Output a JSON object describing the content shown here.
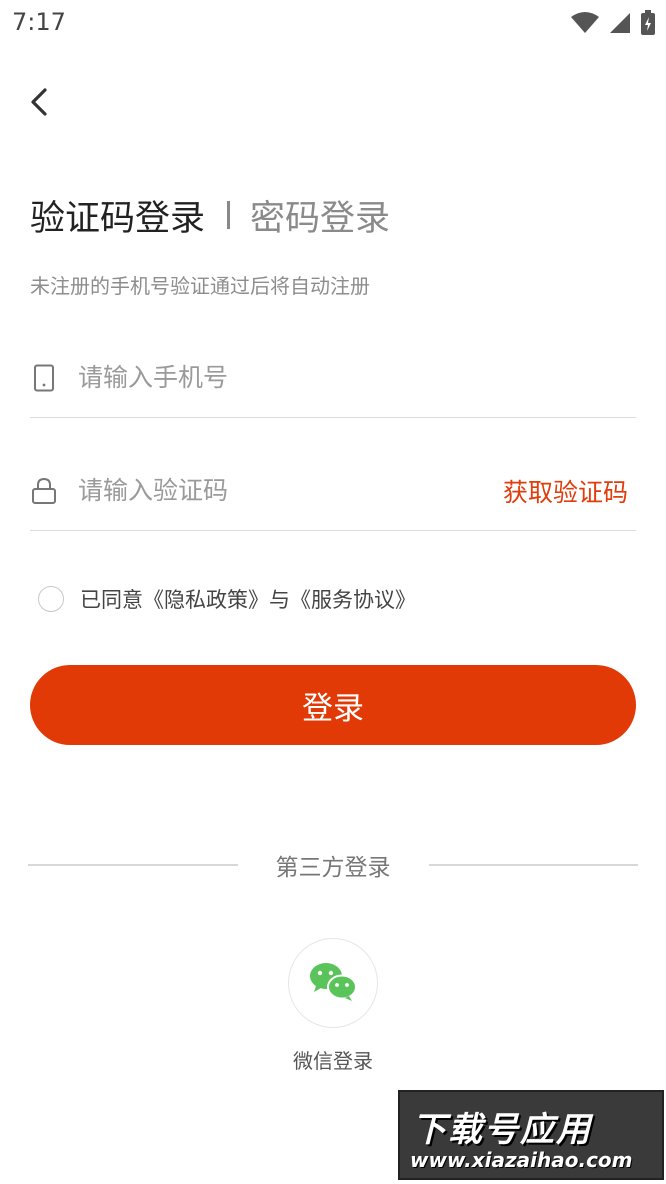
{
  "status_bar": {
    "time": "7:17",
    "icons": [
      "wifi-icon",
      "signal-icon",
      "battery-icon"
    ]
  },
  "nav": {
    "back_icon": "back-arrow-icon"
  },
  "tabs": {
    "active": "验证码登录",
    "inactive": "密码登录"
  },
  "hint": "未注册的手机号验证通过后将自动注册",
  "form": {
    "phone_placeholder": "请输入手机号",
    "code_placeholder": "请输入验证码",
    "get_code_label": "获取验证码"
  },
  "agreement": {
    "text": "已同意《隐私政策》与《服务协议》"
  },
  "login_button": "登录",
  "third_party": {
    "title": "第三方登录",
    "wechat_label": "微信登录"
  },
  "watermark": {
    "title": "下载号应用",
    "url": "www.xiazaihao.com"
  },
  "colors": {
    "accent": "#e23a06",
    "get_code": "#e03c0c",
    "wechat_green": "#5ac35a"
  }
}
